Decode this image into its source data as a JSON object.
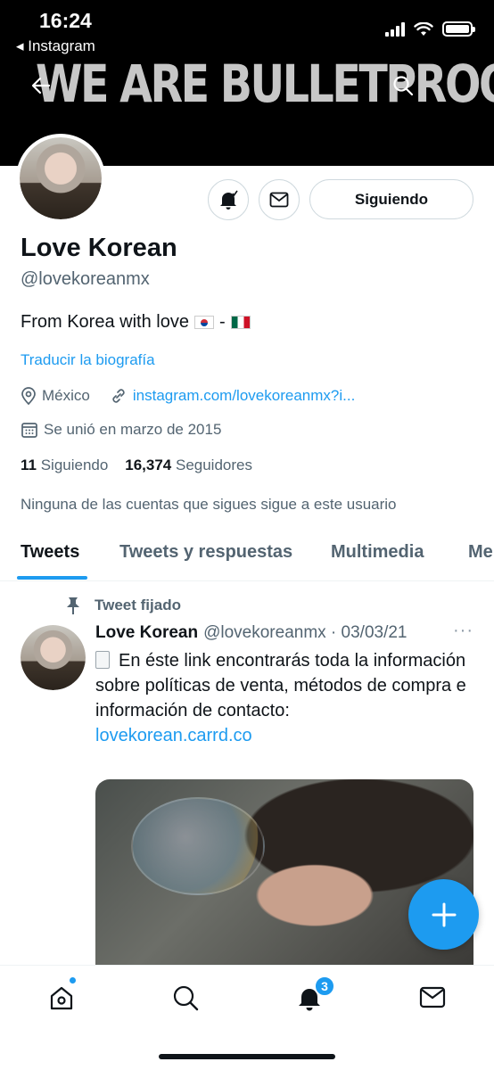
{
  "status_bar": {
    "time": "16:24",
    "back_app": "◂ Instagram"
  },
  "banner": {
    "text": "WE ARE BULLETPROOF"
  },
  "profile": {
    "name": "Love Korean",
    "handle": "@lovekoreanmx",
    "bio": "From Korea with love",
    "bio_separator": "-",
    "translate_label": "Traducir la biografía",
    "location": "México",
    "website": "instagram.com/lovekoreanmx?i...",
    "joined": "Se unió en marzo de 2015",
    "following_count": "11",
    "following_label": "Siguiendo",
    "followers_count": "16,374",
    "followers_label": "Seguidores",
    "followers_note": "Ninguna de las cuentas que sigues sigue a este usuario",
    "follow_button": "Siguiendo"
  },
  "tabs": [
    {
      "label": "Tweets",
      "active": true
    },
    {
      "label": "Tweets y respuestas",
      "active": false
    },
    {
      "label": "Multimedia",
      "active": false
    },
    {
      "label": "Me",
      "active": false
    }
  ],
  "tweet": {
    "pinned_label": "Tweet fijado",
    "author": "Love Korean",
    "handle_date": "@lovekoreanmx · 03/03/21",
    "more": "···",
    "text": "En éste link encontrarás toda la información sobre políticas de venta, métodos de compra e información de contacto:",
    "link": "lovekorean.carrd.co"
  },
  "bottom_nav": {
    "notifications_badge": "3"
  },
  "colors": {
    "accent": "#1d9bf0",
    "text": "#0f1419",
    "secondary": "#536471",
    "banner_bg": "#000000"
  },
  "icons": [
    "back-arrow-icon",
    "search-icon",
    "notification-bell-icon",
    "mail-icon",
    "location-icon",
    "link-icon",
    "calendar-icon",
    "pin-icon",
    "compose-plus-icon",
    "home-icon",
    "explore-search-icon",
    "bell-icon",
    "messages-icon"
  ]
}
